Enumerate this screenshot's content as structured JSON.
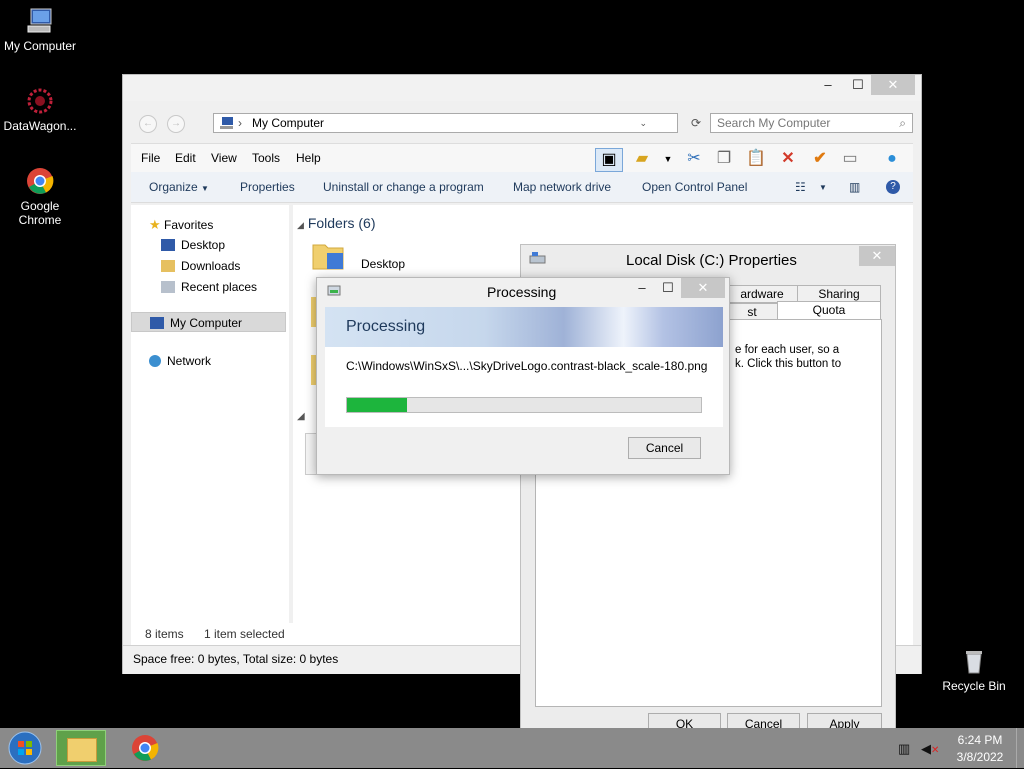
{
  "desktop": {
    "icons": [
      {
        "label": "My Computer"
      },
      {
        "label": "DataWagon..."
      },
      {
        "label": "Google Chrome"
      },
      {
        "label": "Recycle Bin"
      }
    ]
  },
  "explorer": {
    "address": "My Computer",
    "search_placeholder": "Search My Computer",
    "menu": [
      "File",
      "Edit",
      "View",
      "Tools",
      "Help"
    ],
    "commands": [
      "Organize",
      "Properties",
      "Uninstall or change a program",
      "Map network drive",
      "Open Control Panel"
    ],
    "nav": {
      "favorites": "Favorites",
      "favorites_items": [
        "Desktop",
        "Downloads",
        "Recent places"
      ],
      "my_computer": "My Computer",
      "network": "Network"
    },
    "folders_header": "Folders (6)",
    "folder_first": "Desktop",
    "status_items": "8 items",
    "status_selected": "1 item selected",
    "space_info": "Space free: 0 bytes, Total size: 0 bytes"
  },
  "properties_dialog": {
    "title": "Local Disk (C:) Properties",
    "tabs_row1": [
      "ardware",
      "Sharing"
    ],
    "tabs_row2": [
      "st",
      "Quota"
    ],
    "text_line1": "e for each user, so a",
    "text_line2": "k. Click this button to",
    "buttons": {
      "ok": "OK",
      "cancel": "Cancel",
      "apply": "Apply"
    }
  },
  "processing_dialog": {
    "title": "Processing",
    "heading": "Processing",
    "file_path": "C:\\Windows\\WinSxS\\...\\SkyDriveLogo.contrast-black_scale-180.png",
    "progress_percent": 17,
    "cancel": "Cancel"
  },
  "taskbar": {
    "time": "6:24 PM",
    "date": "3/8/2022"
  },
  "colors": {
    "progress": "#1db53d",
    "banner_text": "#1e395b"
  }
}
